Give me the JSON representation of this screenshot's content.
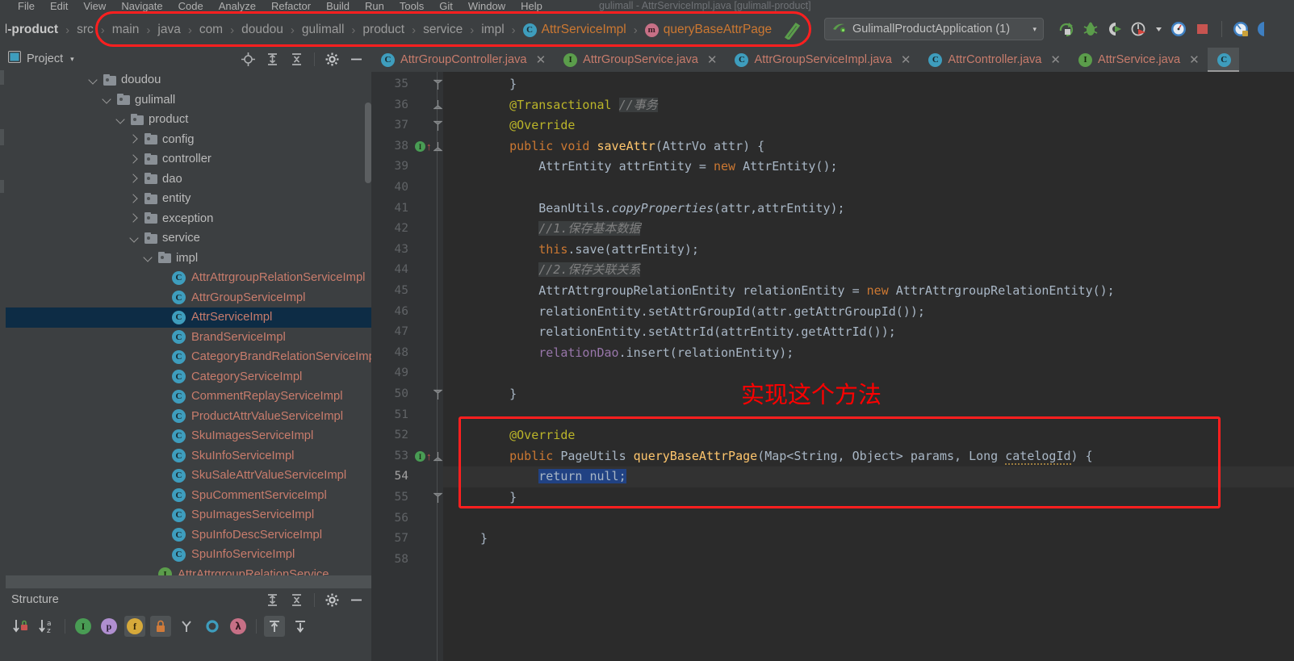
{
  "window": {
    "title": "gulimall - AttrServiceImpl.java [gulimall-product]"
  },
  "menubar": {
    "items": [
      "File",
      "Edit",
      "View",
      "Navigate",
      "Code",
      "Analyze",
      "Refactor",
      "Build",
      "Run",
      "Tools",
      "Git",
      "Window",
      "Help"
    ]
  },
  "breadcrumb": {
    "items": [
      {
        "label": "all-product",
        "kind": "module"
      },
      {
        "label": "src",
        "kind": "dir"
      },
      {
        "label": "main",
        "kind": "dir"
      },
      {
        "label": "java",
        "kind": "dir"
      },
      {
        "label": "com",
        "kind": "dir"
      },
      {
        "label": "doudou",
        "kind": "dir"
      },
      {
        "label": "gulimall",
        "kind": "dir"
      },
      {
        "label": "product",
        "kind": "dir"
      },
      {
        "label": "service",
        "kind": "dir"
      },
      {
        "label": "impl",
        "kind": "dir"
      },
      {
        "label": "AttrServiceImpl",
        "kind": "class",
        "icon": "C"
      },
      {
        "label": "queryBaseAttrPage",
        "kind": "method",
        "icon": "m"
      }
    ]
  },
  "run_config": {
    "name": "GulimallProductApplication (1)",
    "caret": "▾"
  },
  "toolbar_icons": [
    "rerun-icon",
    "debug-icon",
    "run-with-coverage-icon",
    "profile-icon",
    "profile-dropdown-icon",
    "update-app-icon",
    "stop-icon",
    "search-everywhere-icon",
    "settings-icon"
  ],
  "project_panel": {
    "title": "Project",
    "caret": "▾",
    "actions": [
      "locate-icon",
      "expand-all-icon",
      "collapse-all-icon",
      "gear-icon",
      "hide-icon"
    ],
    "tree": [
      {
        "label": "doudou",
        "type": "folder",
        "indent": 6,
        "arrow": "down"
      },
      {
        "label": "gulimall",
        "type": "folder",
        "indent": 7,
        "arrow": "down"
      },
      {
        "label": "product",
        "type": "folder",
        "indent": 8,
        "arrow": "down"
      },
      {
        "label": "config",
        "type": "folder",
        "indent": 9,
        "arrow": "right"
      },
      {
        "label": "controller",
        "type": "folder",
        "indent": 9,
        "arrow": "right"
      },
      {
        "label": "dao",
        "type": "folder",
        "indent": 9,
        "arrow": "right"
      },
      {
        "label": "entity",
        "type": "folder",
        "indent": 9,
        "arrow": "right"
      },
      {
        "label": "exception",
        "type": "folder",
        "indent": 9,
        "arrow": "right"
      },
      {
        "label": "service",
        "type": "folder",
        "indent": 9,
        "arrow": "down"
      },
      {
        "label": "impl",
        "type": "folder",
        "indent": 10,
        "arrow": "down"
      },
      {
        "label": "AttrAttrgroupRelationServiceImpl",
        "type": "class",
        "indent": 11,
        "arrow": "none"
      },
      {
        "label": "AttrGroupServiceImpl",
        "type": "class",
        "indent": 11,
        "arrow": "none"
      },
      {
        "label": "AttrServiceImpl",
        "type": "class",
        "indent": 11,
        "arrow": "none",
        "selected": true
      },
      {
        "label": "BrandServiceImpl",
        "type": "class",
        "indent": 11,
        "arrow": "none"
      },
      {
        "label": "CategoryBrandRelationServiceImpl",
        "type": "class",
        "indent": 11,
        "arrow": "none"
      },
      {
        "label": "CategoryServiceImpl",
        "type": "class",
        "indent": 11,
        "arrow": "none"
      },
      {
        "label": "CommentReplayServiceImpl",
        "type": "class",
        "indent": 11,
        "arrow": "none"
      },
      {
        "label": "ProductAttrValueServiceImpl",
        "type": "class",
        "indent": 11,
        "arrow": "none"
      },
      {
        "label": "SkuImagesServiceImpl",
        "type": "class",
        "indent": 11,
        "arrow": "none"
      },
      {
        "label": "SkuInfoServiceImpl",
        "type": "class",
        "indent": 11,
        "arrow": "none"
      },
      {
        "label": "SkuSaleAttrValueServiceImpl",
        "type": "class",
        "indent": 11,
        "arrow": "none"
      },
      {
        "label": "SpuCommentServiceImpl",
        "type": "class",
        "indent": 11,
        "arrow": "none"
      },
      {
        "label": "SpuImagesServiceImpl",
        "type": "class",
        "indent": 11,
        "arrow": "none"
      },
      {
        "label": "SpuInfoDescServiceImpl",
        "type": "class",
        "indent": 11,
        "arrow": "none"
      },
      {
        "label": "SpuInfoServiceImpl",
        "type": "class",
        "indent": 11,
        "arrow": "none"
      },
      {
        "label": "AttrAttrgroupRelationService",
        "type": "iface",
        "indent": 10,
        "arrow": "none"
      }
    ]
  },
  "structure_panel": {
    "title": "Structure",
    "actions": [
      "expand-all-icon",
      "collapse-all-icon",
      "gear-icon",
      "hide-icon"
    ],
    "tools": [
      {
        "name": "sort-by-visibility-icon",
        "glyph": "↓",
        "active": false
      },
      {
        "name": "sort-alphabetically-icon",
        "glyph": "↓",
        "active": false
      },
      {
        "name": "show-inherited-icon",
        "glyph": "I",
        "active": false,
        "color": "#499c54"
      },
      {
        "name": "show-properties-icon",
        "glyph": "p",
        "active": false,
        "color": "#b08fd0"
      },
      {
        "name": "show-fields-icon",
        "glyph": "f",
        "active": true,
        "color": "#d6a котор"
      },
      {
        "name": "show-non-public-icon",
        "glyph": "■",
        "active": true,
        "color": "#d07b3a"
      },
      {
        "name": "show-anonymous-classes-icon",
        "glyph": "Y",
        "active": false,
        "color": "#a0a0a0"
      },
      {
        "name": "show-interfaces-icon",
        "glyph": "O",
        "active": false,
        "color": "#3e9dbd"
      },
      {
        "name": "show-lambdas-icon",
        "glyph": "λ",
        "active": false,
        "color": "#c77086"
      },
      {
        "name": "autoscroll-to-source-icon",
        "glyph": "↑",
        "active": true
      },
      {
        "name": "autoscroll-from-source-icon",
        "glyph": "↓",
        "active": false
      }
    ]
  },
  "editor_tabs": [
    {
      "label": "AttrGroupController.java",
      "icon": "C",
      "kind": "class",
      "active": false
    },
    {
      "label": "AttrGroupService.java",
      "icon": "I",
      "kind": "iface",
      "active": false
    },
    {
      "label": "AttrGroupServiceImpl.java",
      "icon": "C",
      "kind": "class",
      "active": false
    },
    {
      "label": "AttrController.java",
      "icon": "C",
      "kind": "class",
      "active": false
    },
    {
      "label": "AttrService.java",
      "icon": "I",
      "kind": "iface",
      "active": false
    },
    {
      "label": "",
      "icon": "C",
      "kind": "class",
      "active": true
    }
  ],
  "editor": {
    "first_line": 35,
    "current_line": 54,
    "lines": [
      {
        "n": 35,
        "indent": 1,
        "fold": "end",
        "tokens": [
          {
            "t": "}",
            "c": "plain"
          }
        ]
      },
      {
        "n": 36,
        "indent": 1,
        "fold": "mid",
        "tokens": [
          {
            "t": "@Transactional",
            "c": "ann"
          },
          {
            "t": " ",
            "c": "plain"
          },
          {
            "t": "//事务",
            "c": "cmt"
          }
        ]
      },
      {
        "n": 37,
        "indent": 1,
        "fold": "end",
        "tokens": [
          {
            "t": "@Override",
            "c": "ann"
          }
        ]
      },
      {
        "n": 38,
        "indent": 1,
        "fold": "mid",
        "gutter": "override-up",
        "tokens": [
          {
            "t": "public",
            "c": "kw"
          },
          {
            "t": " ",
            "c": "plain"
          },
          {
            "t": "void",
            "c": "kw"
          },
          {
            "t": " ",
            "c": "plain"
          },
          {
            "t": "saveAttr",
            "c": "mthd"
          },
          {
            "t": "(AttrVo attr) {",
            "c": "plain"
          }
        ]
      },
      {
        "n": 39,
        "indent": 2,
        "tokens": [
          {
            "t": "AttrEntity attrEntity = ",
            "c": "plain"
          },
          {
            "t": "new",
            "c": "kw"
          },
          {
            "t": " AttrEntity();",
            "c": "plain"
          }
        ]
      },
      {
        "n": 40,
        "indent": 0,
        "tokens": []
      },
      {
        "n": 41,
        "indent": 2,
        "tokens": [
          {
            "t": "BeanUtils.",
            "c": "plain"
          },
          {
            "t": "copyProperties",
            "c": "stat"
          },
          {
            "t": "(attr,attrEntity);",
            "c": "plain"
          }
        ]
      },
      {
        "n": 42,
        "indent": 2,
        "tokens": [
          {
            "t": "//1.保存基本数据",
            "c": "cmt"
          }
        ]
      },
      {
        "n": 43,
        "indent": 2,
        "tokens": [
          {
            "t": "this",
            "c": "kw"
          },
          {
            "t": ".save(attrEntity);",
            "c": "plain"
          }
        ]
      },
      {
        "n": 44,
        "indent": 2,
        "tokens": [
          {
            "t": "//2.保存关联关系",
            "c": "cmt"
          }
        ]
      },
      {
        "n": 45,
        "indent": 2,
        "tokens": [
          {
            "t": "AttrAttrgroupRelationEntity relationEntity = ",
            "c": "plain"
          },
          {
            "t": "new",
            "c": "kw"
          },
          {
            "t": " AttrAttrgroupRelationEntity();",
            "c": "plain"
          }
        ]
      },
      {
        "n": 46,
        "indent": 2,
        "tokens": [
          {
            "t": "relationEntity.setAttrGroupId(attr.getAttrGroupId());",
            "c": "plain"
          }
        ]
      },
      {
        "n": 47,
        "indent": 2,
        "tokens": [
          {
            "t": "relationEntity.setAttrId(attrEntity.getAttrId());",
            "c": "plain"
          }
        ]
      },
      {
        "n": 48,
        "indent": 2,
        "tokens": [
          {
            "t": "relationDao",
            "c": "fld"
          },
          {
            "t": ".insert(relationEntity);",
            "c": "plain"
          }
        ]
      },
      {
        "n": 49,
        "indent": 0,
        "tokens": []
      },
      {
        "n": 50,
        "indent": 1,
        "fold": "end",
        "tokens": [
          {
            "t": "}",
            "c": "plain"
          }
        ]
      },
      {
        "n": 51,
        "indent": 0,
        "tokens": []
      },
      {
        "n": 52,
        "indent": 1,
        "tokens": [
          {
            "t": "@Override",
            "c": "ann"
          }
        ]
      },
      {
        "n": 53,
        "indent": 1,
        "fold": "mid",
        "gutter": "override-up",
        "tokens": [
          {
            "t": "public",
            "c": "kw"
          },
          {
            "t": " PageUtils ",
            "c": "plain"
          },
          {
            "t": "queryBaseAttrPage",
            "c": "mthd"
          },
          {
            "t": "(Map<String, Object> params, Long ",
            "c": "plain"
          },
          {
            "t": "catelogId",
            "c": "warn"
          },
          {
            "t": ") {",
            "c": "plain"
          }
        ]
      },
      {
        "n": 54,
        "indent": 2,
        "current": true,
        "tokens": [
          {
            "t": "return null;",
            "c": "sel"
          }
        ]
      },
      {
        "n": 55,
        "indent": 1,
        "fold": "end",
        "tokens": [
          {
            "t": "}",
            "c": "plain"
          }
        ]
      },
      {
        "n": 56,
        "indent": 0,
        "tokens": []
      },
      {
        "n": 57,
        "indent": 0,
        "tokens": [
          {
            "t": "}",
            "c": "plain"
          }
        ]
      },
      {
        "n": 58,
        "indent": 0,
        "tokens": []
      }
    ]
  },
  "annotations": {
    "red_note": "实现这个方法",
    "red_note_color": "#ff0000",
    "box_color": "#ff1f1f"
  }
}
